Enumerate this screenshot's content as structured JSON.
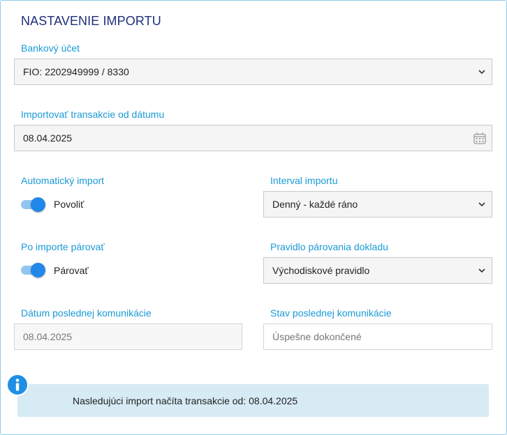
{
  "section": {
    "title": "NASTAVENIE IMPORTU"
  },
  "bank_account": {
    "label": "Bankový účet",
    "value": "FIO: 2202949999 / 8330"
  },
  "import_from": {
    "label": "Importovať transakcie od dátumu",
    "value": "08.04.2025"
  },
  "auto_import": {
    "label": "Automatický import",
    "toggle_label": "Povoliť",
    "enabled": true
  },
  "import_interval": {
    "label": "Interval importu",
    "value": "Denný - každé ráno"
  },
  "pair_after_import": {
    "label": "Po importe párovať",
    "toggle_label": "Párovať",
    "enabled": true
  },
  "pairing_rule": {
    "label": "Pravidlo párovania dokladu",
    "value": "Východiskové pravidlo"
  },
  "last_communication_date": {
    "label": "Dátum poslednej komunikácie",
    "value": "08.04.2025"
  },
  "last_communication_status": {
    "label": "Stav poslednej komunikácie",
    "value": "Úspešne dokončené"
  },
  "info": {
    "text": "Nasledujúci import načíta transakcie od: 08.04.2025",
    "icon": "info-icon"
  },
  "colors": {
    "title": "#1e2f7a",
    "label": "#1a9ad6",
    "toggle_on": "#2187e8",
    "info_bg": "#d7ebf5"
  }
}
